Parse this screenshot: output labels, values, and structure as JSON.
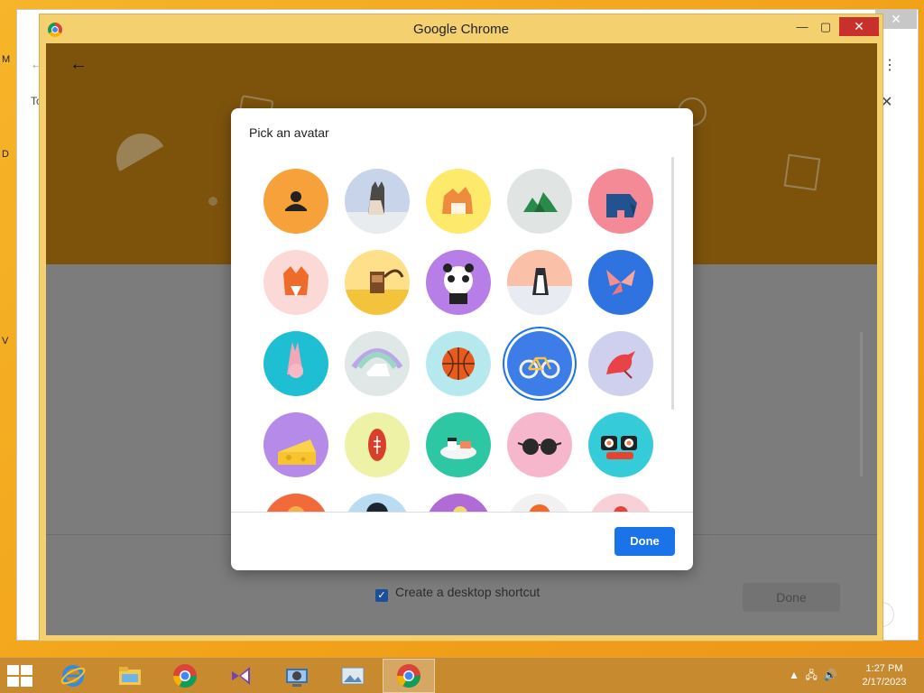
{
  "window": {
    "title": "Google Chrome"
  },
  "background_window": {
    "left_letters": [
      "M",
      "D",
      "V"
    ],
    "tab_text": "To"
  },
  "dialog": {
    "title": "Pick an avatar",
    "done_label": "Done",
    "selected_avatar": "bicycle",
    "avatars": [
      {
        "name": "generic-person",
        "bg": "#f7a13a"
      },
      {
        "name": "cat",
        "bg": "#c8d4ea"
      },
      {
        "name": "corgi",
        "bg": "#fde96a"
      },
      {
        "name": "dragon",
        "bg": "#e0e4e3"
      },
      {
        "name": "elephant",
        "bg": "#f48a96"
      },
      {
        "name": "fox",
        "bg": "#fbd9d6"
      },
      {
        "name": "monkey",
        "bg": "#fde089"
      },
      {
        "name": "panda",
        "bg": "#b67ee6"
      },
      {
        "name": "penguin",
        "bg": "#f9b8a7"
      },
      {
        "name": "butterfly",
        "bg": "#2f73e0"
      },
      {
        "name": "rabbit",
        "bg": "#1fbfd3"
      },
      {
        "name": "unicorn",
        "bg": "#dfe8e6"
      },
      {
        "name": "basketball",
        "bg": "#b6e9ee"
      },
      {
        "name": "bicycle",
        "bg": "#3c7de8"
      },
      {
        "name": "bird",
        "bg": "#cfd0ee"
      },
      {
        "name": "cheese",
        "bg": "#b68ae8"
      },
      {
        "name": "football",
        "bg": "#eef2a7"
      },
      {
        "name": "sushi-plate",
        "bg": "#2ec7a3"
      },
      {
        "name": "sunglasses",
        "bg": "#f6b6cc"
      },
      {
        "name": "sushi-rolls",
        "bg": "#35cbd8"
      },
      {
        "name": "avatar-21",
        "bg": "#f36a3a"
      },
      {
        "name": "avatar-22",
        "bg": "#b9dcf2"
      },
      {
        "name": "avatar-23",
        "bg": "#b06bd6"
      },
      {
        "name": "avatar-24",
        "bg": "#f1f1f1"
      },
      {
        "name": "avatar-25",
        "bg": "#f8d1d8"
      }
    ]
  },
  "page_behind": {
    "shortcut_label": "Create a desktop shortcut",
    "done_label": "Done"
  },
  "taskbar": {
    "items": [
      {
        "name": "internet-explorer",
        "active": false
      },
      {
        "name": "file-explorer",
        "active": false
      },
      {
        "name": "chrome",
        "active": false
      },
      {
        "name": "visual-studio",
        "active": false
      },
      {
        "name": "control-panel",
        "active": false
      },
      {
        "name": "image-viewer",
        "active": false
      },
      {
        "name": "chrome-active",
        "active": true
      }
    ],
    "time": "1:27 PM",
    "date": "2/17/2023"
  },
  "colors": {
    "desktop": "#f2a319",
    "window_frame": "#f4d06f",
    "banner": "#7d530c",
    "accent": "#1a73e8"
  }
}
